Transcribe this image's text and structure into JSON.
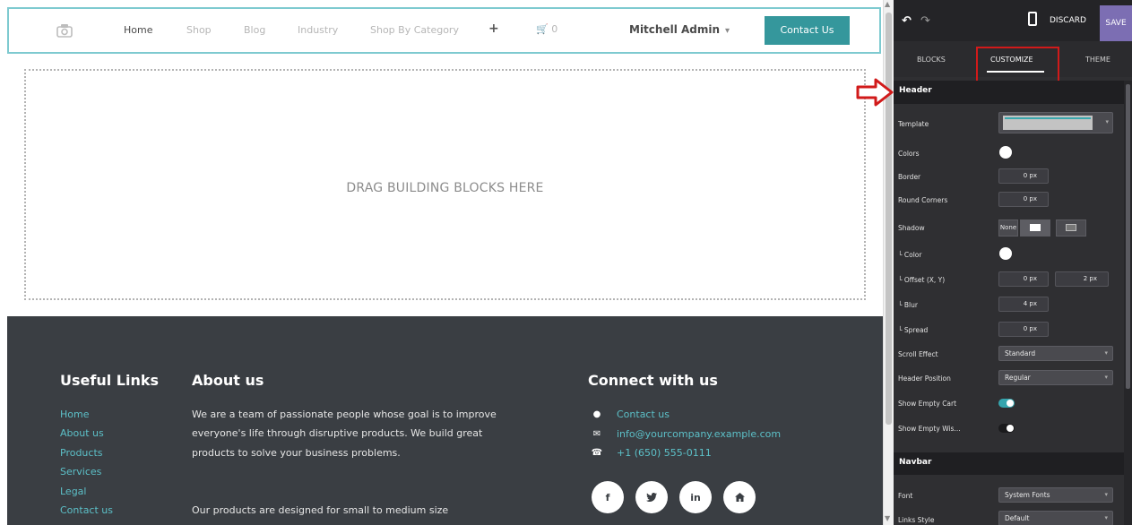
{
  "site": {
    "nav": {
      "home": "Home",
      "shop": "Shop",
      "blog": "Blog",
      "industry": "Industry",
      "shop_by_category": "Shop By Category",
      "plus": "+",
      "cart_count": "0",
      "user": "Mitchell Admin",
      "contact_button": "Contact Us"
    },
    "dropzone_text": "DRAG BUILDING BLOCKS HERE",
    "footer": {
      "useful_links_title": "Useful Links",
      "links": [
        "Home",
        "About us",
        "Products",
        "Services",
        "Legal",
        "Contact us"
      ],
      "about_title": "About us",
      "about_text": "We are a team of passionate people whose goal is to improve everyone's life through disruptive products. We build great products to solve your business problems.",
      "about_text_2": "Our products are designed for small to medium size",
      "connect_title": "Connect with us",
      "contacts": [
        {
          "icon": "comment-icon",
          "text": "Contact us"
        },
        {
          "icon": "envelope-icon",
          "text": "info@yourcompany.example.com"
        },
        {
          "icon": "phone-icon",
          "text": "+1 (650) 555-0111"
        }
      ],
      "social": [
        "f",
        "t",
        "in",
        "home"
      ]
    }
  },
  "panel": {
    "toolbar": {
      "discard": "DISCARD",
      "save": "SAVE"
    },
    "tabs": {
      "blocks": "BLOCKS",
      "customize": "CUSTOMIZE",
      "theme": "THEME"
    },
    "header_section": {
      "title": "Header",
      "template_label": "Template",
      "colors_label": "Colors",
      "border_label": "Border",
      "border_value": "0",
      "border_unit": "px",
      "round_corners_label": "Round Corners",
      "round_corners_value": "0",
      "round_corners_unit": "px",
      "shadow_label": "Shadow",
      "shadow_none": "None",
      "shadow_color_label": "└ Color",
      "shadow_offset_label": "└ Offset (X, Y)",
      "shadow_offset_x": "0",
      "shadow_offset_y": "2",
      "shadow_offset_unit": "px",
      "shadow_blur_label": "└ Blur",
      "shadow_blur_value": "4",
      "shadow_blur_unit": "px",
      "shadow_spread_label": "└ Spread",
      "shadow_spread_value": "0",
      "shadow_spread_unit": "px",
      "scroll_effect_label": "Scroll Effect",
      "scroll_effect_value": "Standard",
      "header_position_label": "Header Position",
      "header_position_value": "Regular",
      "show_empty_cart_label": "Show Empty Cart",
      "show_empty_cart_on": true,
      "show_empty_wishlist_label": "Show Empty Wis...",
      "show_empty_wishlist_on": false
    },
    "navbar_section": {
      "title": "Navbar",
      "font_label": "Font",
      "font_value": "System Fonts",
      "links_style_label": "Links Style",
      "links_style_value": "Default"
    }
  },
  "colors": {
    "accent_teal": "#35979c",
    "footer_bg": "#3a3e43",
    "panel_bg": "#2f2f32",
    "save_purple": "#7c6eb3",
    "highlight_red": "#d11a1a"
  }
}
